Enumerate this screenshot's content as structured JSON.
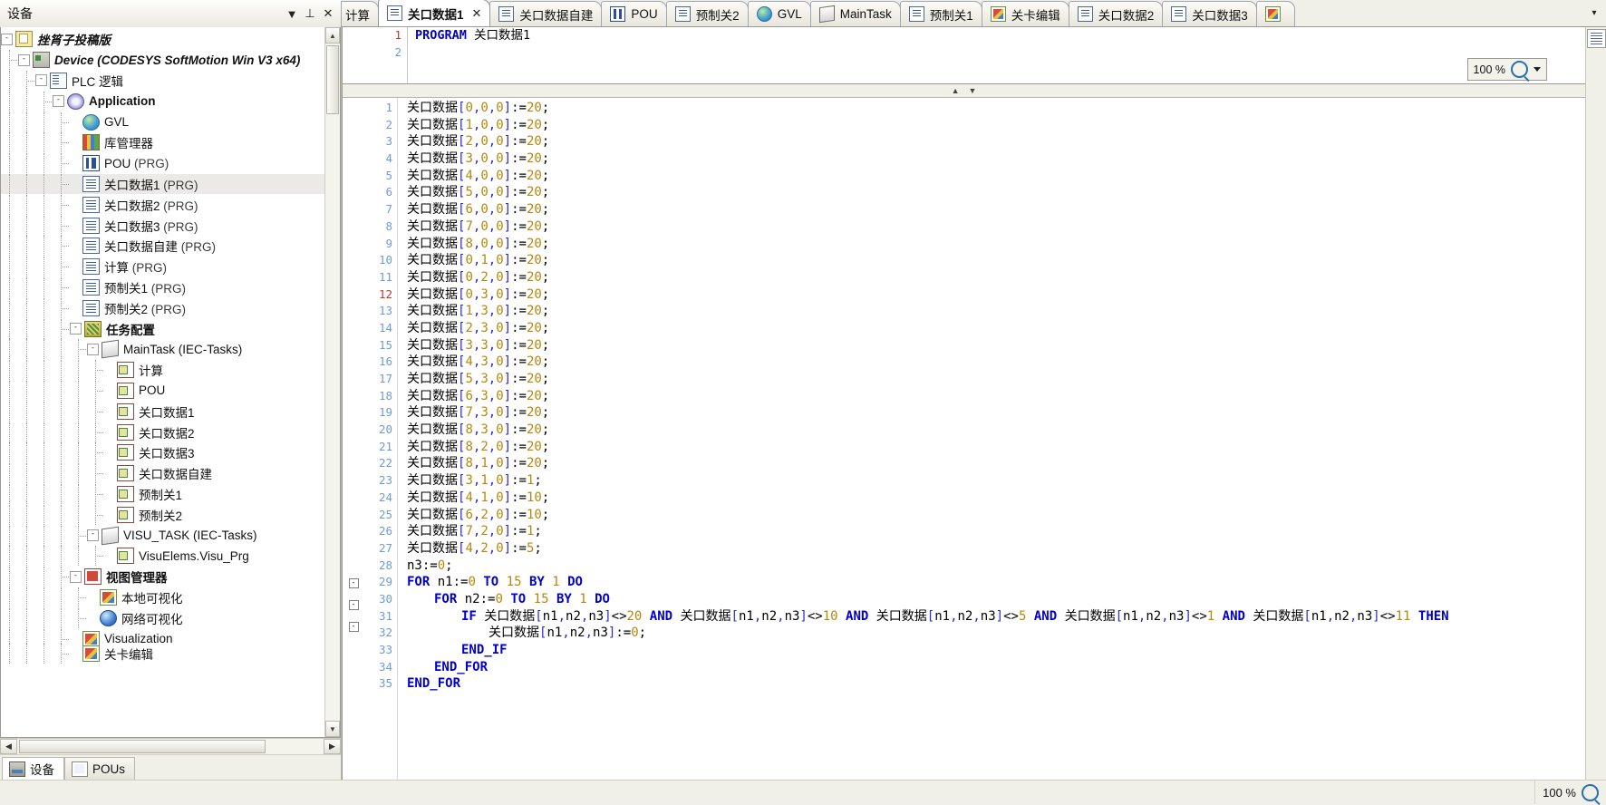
{
  "devices_panel": {
    "title": "设备",
    "tools": [
      {
        "name": "dropdown-icon",
        "glyph": "▼"
      },
      {
        "name": "pin-icon",
        "glyph": "⊥"
      },
      {
        "name": "close-icon",
        "glyph": "✕"
      }
    ],
    "tree": [
      {
        "label": "挫筲子投稿版",
        "indent": 0,
        "icon": "i-proj",
        "expander": "-",
        "style": "ital",
        "suffix": ""
      },
      {
        "label": "Device (CODESYS SoftMotion Win V3 x64)",
        "indent": 1,
        "icon": "i-dev",
        "expander": "-",
        "style": "ital",
        "suffix": ""
      },
      {
        "label": "PLC 逻辑",
        "indent": 2,
        "icon": "i-plc",
        "expander": "-",
        "style": "",
        "suffix": ""
      },
      {
        "label": "Application",
        "indent": 3,
        "icon": "i-app",
        "expander": "-",
        "style": "bold",
        "suffix": ""
      },
      {
        "label": "GVL",
        "indent": 4,
        "icon": "i-gvl",
        "expander": "",
        "style": "",
        "suffix": ""
      },
      {
        "label": "库管理器",
        "indent": 4,
        "icon": "i-lib",
        "expander": "",
        "style": "",
        "suffix": ""
      },
      {
        "label": "POU",
        "indent": 4,
        "icon": "i-pou",
        "expander": "",
        "style": "",
        "suffix": " (PRG)"
      },
      {
        "label": "关口数据1",
        "indent": 4,
        "icon": "i-doc",
        "expander": "",
        "style": "",
        "suffix": " (PRG)",
        "selected": true
      },
      {
        "label": "关口数据2",
        "indent": 4,
        "icon": "i-doc",
        "expander": "",
        "style": "",
        "suffix": " (PRG)"
      },
      {
        "label": "关口数据3",
        "indent": 4,
        "icon": "i-doc",
        "expander": "",
        "style": "",
        "suffix": " (PRG)"
      },
      {
        "label": "关口数据自建",
        "indent": 4,
        "icon": "i-doc",
        "expander": "",
        "style": "",
        "suffix": " (PRG)"
      },
      {
        "label": "计算",
        "indent": 4,
        "icon": "i-doc",
        "expander": "",
        "style": "",
        "suffix": " (PRG)"
      },
      {
        "label": "预制关1",
        "indent": 4,
        "icon": "i-doc",
        "expander": "",
        "style": "",
        "suffix": " (PRG)"
      },
      {
        "label": "预制关2",
        "indent": 4,
        "icon": "i-doc",
        "expander": "",
        "style": "",
        "suffix": " (PRG)"
      },
      {
        "label": "任务配置",
        "indent": 4,
        "icon": "i-task",
        "expander": "-",
        "style": "bold",
        "suffix": ""
      },
      {
        "label": "MainTask (IEC-Tasks)",
        "indent": 5,
        "icon": "i-stack",
        "expander": "-",
        "style": "",
        "suffix": ""
      },
      {
        "label": "计算",
        "indent": 6,
        "icon": "i-call",
        "expander": "",
        "style": "",
        "suffix": ""
      },
      {
        "label": "POU",
        "indent": 6,
        "icon": "i-call",
        "expander": "",
        "style": "",
        "suffix": ""
      },
      {
        "label": "关口数据1",
        "indent": 6,
        "icon": "i-call",
        "expander": "",
        "style": "",
        "suffix": ""
      },
      {
        "label": "关口数据2",
        "indent": 6,
        "icon": "i-call",
        "expander": "",
        "style": "",
        "suffix": ""
      },
      {
        "label": "关口数据3",
        "indent": 6,
        "icon": "i-call",
        "expander": "",
        "style": "",
        "suffix": ""
      },
      {
        "label": "关口数据自建",
        "indent": 6,
        "icon": "i-call",
        "expander": "",
        "style": "",
        "suffix": ""
      },
      {
        "label": "预制关1",
        "indent": 6,
        "icon": "i-call",
        "expander": "",
        "style": "",
        "suffix": ""
      },
      {
        "label": "预制关2",
        "indent": 6,
        "icon": "i-call",
        "expander": "",
        "style": "",
        "suffix": ""
      },
      {
        "label": "VISU_TASK (IEC-Tasks)",
        "indent": 5,
        "icon": "i-stack",
        "expander": "-",
        "style": "",
        "suffix": ""
      },
      {
        "label": "VisuElems.Visu_Prg",
        "indent": 6,
        "icon": "i-call",
        "expander": "",
        "style": "",
        "suffix": ""
      },
      {
        "label": "视图管理器",
        "indent": 4,
        "icon": "i-visman",
        "expander": "-",
        "style": "bold",
        "suffix": ""
      },
      {
        "label": "本地可视化",
        "indent": 5,
        "icon": "i-visu",
        "expander": "",
        "style": "",
        "suffix": ""
      },
      {
        "label": "网络可视化",
        "indent": 5,
        "icon": "i-web",
        "expander": "",
        "style": "",
        "suffix": ""
      },
      {
        "label": "Visualization",
        "indent": 4,
        "icon": "i-visu",
        "expander": "",
        "style": "",
        "suffix": ""
      },
      {
        "label": "关卡编辑",
        "indent": 4,
        "icon": "i-visu",
        "expander": "",
        "style": "",
        "suffix": "",
        "clipped": true
      }
    ],
    "bottom_tabs": [
      {
        "label": "设备",
        "icon": "i-devtab",
        "active": true
      },
      {
        "label": "POUs",
        "icon": "i-poutab",
        "active": false
      }
    ]
  },
  "tabs": [
    {
      "label": "计算",
      "icon": "i-doc",
      "partial": true,
      "active": false,
      "closable": false
    },
    {
      "label": "关口数据1",
      "icon": "i-doc",
      "partial": false,
      "active": true,
      "closable": true
    },
    {
      "label": "关口数据自建",
      "icon": "i-doc",
      "partial": false,
      "active": false,
      "closable": false
    },
    {
      "label": "POU",
      "icon": "i-pou",
      "partial": false,
      "active": false,
      "closable": false
    },
    {
      "label": "预制关2",
      "icon": "i-doc",
      "partial": false,
      "active": false,
      "closable": false
    },
    {
      "label": "GVL",
      "icon": "i-gvl",
      "partial": false,
      "active": false,
      "closable": false
    },
    {
      "label": "MainTask",
      "icon": "i-stack",
      "partial": false,
      "active": false,
      "closable": false
    },
    {
      "label": "预制关1",
      "icon": "i-doc",
      "partial": false,
      "active": false,
      "closable": false
    },
    {
      "label": "关卡编辑",
      "icon": "i-visu",
      "partial": false,
      "active": false,
      "closable": false
    },
    {
      "label": "关口数据2",
      "icon": "i-doc",
      "partial": false,
      "active": false,
      "closable": false
    },
    {
      "label": "关口数据3",
      "icon": "i-doc",
      "partial": false,
      "active": false,
      "closable": false
    },
    {
      "label": "",
      "icon": "i-visu",
      "partial": false,
      "active": false,
      "closable": false
    }
  ],
  "tabnav": {
    "more_glyph": "▾",
    "left_close_glyph": "✕",
    "left_pin_glyph": "⊥"
  },
  "declaration": {
    "lines": [
      {
        "no": "1",
        "text": "PROGRAM 关口数据1",
        "kw": "PROGRAM",
        "rest": " 关口数据1"
      },
      {
        "no": "2",
        "text": "",
        "kw": "",
        "rest": ""
      }
    ],
    "zoom_label": "100 %"
  },
  "code": {
    "zoom_label": "100 %",
    "lines": [
      {
        "no": "1",
        "fold": "",
        "indent": 0,
        "text": "关口数据[0,0,0]:=20;"
      },
      {
        "no": "2",
        "fold": "",
        "indent": 0,
        "text": "关口数据[1,0,0]:=20;"
      },
      {
        "no": "3",
        "fold": "",
        "indent": 0,
        "text": "关口数据[2,0,0]:=20;"
      },
      {
        "no": "4",
        "fold": "",
        "indent": 0,
        "text": "关口数据[3,0,0]:=20;"
      },
      {
        "no": "5",
        "fold": "",
        "indent": 0,
        "text": "关口数据[4,0,0]:=20;"
      },
      {
        "no": "6",
        "fold": "",
        "indent": 0,
        "text": "关口数据[5,0,0]:=20;"
      },
      {
        "no": "7",
        "fold": "",
        "indent": 0,
        "text": "关口数据[6,0,0]:=20;"
      },
      {
        "no": "8",
        "fold": "",
        "indent": 0,
        "text": "关口数据[7,0,0]:=20;"
      },
      {
        "no": "9",
        "fold": "",
        "indent": 0,
        "text": "关口数据[8,0,0]:=20;"
      },
      {
        "no": "10",
        "fold": "",
        "indent": 0,
        "text": "关口数据[0,1,0]:=20;"
      },
      {
        "no": "11",
        "fold": "",
        "indent": 0,
        "text": "关口数据[0,2,0]:=20;"
      },
      {
        "no": "12",
        "fold": "",
        "indent": 0,
        "text": "关口数据[0,3,0]:=20;",
        "numred": true
      },
      {
        "no": "13",
        "fold": "",
        "indent": 0,
        "text": "关口数据[1,3,0]:=20;"
      },
      {
        "no": "14",
        "fold": "",
        "indent": 0,
        "text": "关口数据[2,3,0]:=20;"
      },
      {
        "no": "15",
        "fold": "",
        "indent": 0,
        "text": "关口数据[3,3,0]:=20;"
      },
      {
        "no": "16",
        "fold": "",
        "indent": 0,
        "text": "关口数据[4,3,0]:=20;"
      },
      {
        "no": "17",
        "fold": "",
        "indent": 0,
        "text": "关口数据[5,3,0]:=20;"
      },
      {
        "no": "18",
        "fold": "",
        "indent": 0,
        "text": "关口数据[6,3,0]:=20;"
      },
      {
        "no": "19",
        "fold": "",
        "indent": 0,
        "text": "关口数据[7,3,0]:=20;"
      },
      {
        "no": "20",
        "fold": "",
        "indent": 0,
        "text": "关口数据[8,3,0]:=20;"
      },
      {
        "no": "21",
        "fold": "",
        "indent": 0,
        "text": "关口数据[8,2,0]:=20;"
      },
      {
        "no": "22",
        "fold": "",
        "indent": 0,
        "text": "关口数据[8,1,0]:=20;"
      },
      {
        "no": "23",
        "fold": "",
        "indent": 0,
        "text": "关口数据[3,1,0]:=1;"
      },
      {
        "no": "24",
        "fold": "",
        "indent": 0,
        "text": "关口数据[4,1,0]:=10;"
      },
      {
        "no": "25",
        "fold": "",
        "indent": 0,
        "text": "关口数据[6,2,0]:=10;"
      },
      {
        "no": "26",
        "fold": "",
        "indent": 0,
        "text": "关口数据[7,2,0]:=1;"
      },
      {
        "no": "27",
        "fold": "",
        "indent": 0,
        "text": "关口数据[4,2,0]:=5;"
      },
      {
        "no": "28",
        "fold": "",
        "indent": 0,
        "text": "n3:=0;"
      },
      {
        "no": "29",
        "fold": "-",
        "indent": 0,
        "text": "FOR n1:=0 TO 15 BY 1 DO"
      },
      {
        "no": "30",
        "fold": "-",
        "indent": 1,
        "text": "FOR n2:=0 TO 15 BY 1 DO"
      },
      {
        "no": "31",
        "fold": "-",
        "indent": 2,
        "text": "IF 关口数据[n1,n2,n3]<>20 AND 关口数据[n1,n2,n3]<>10 AND 关口数据[n1,n2,n3]<>5 AND 关口数据[n1,n2,n3]<>1 AND 关口数据[n1,n2,n3]<>11 THEN"
      },
      {
        "no": "32",
        "fold": "",
        "indent": 3,
        "text": "关口数据[n1,n2,n3]:=0;"
      },
      {
        "no": "33",
        "fold": "",
        "indent": 2,
        "text": "END_IF"
      },
      {
        "no": "34",
        "fold": "",
        "indent": 1,
        "text": "END_FOR"
      },
      {
        "no": "35",
        "fold": "",
        "indent": 0,
        "text": "END_FOR"
      }
    ]
  },
  "statusbar": {
    "zoom_label": "100 %"
  },
  "colors": {
    "keyword": "#0000cc",
    "number": "#b8860b",
    "bracket": "#2b2bd0",
    "linenumber": "#6f9bd4",
    "linenumber_marked": "#c0392b",
    "selection": "#eceae6",
    "chrome": "#f0efe8"
  }
}
